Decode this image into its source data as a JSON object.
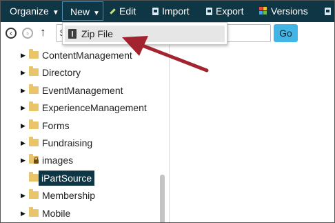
{
  "menubar": {
    "organize": "Organize",
    "new": "New",
    "edit": "Edit",
    "import": "Import",
    "export": "Export",
    "versions": "Versions",
    "caret": "▼"
  },
  "toolbar": {
    "path_value": "$",
    "go_label": "Go"
  },
  "dropdown": {
    "items": [
      {
        "label": "Zip File",
        "icon": "zip-file-icon"
      }
    ]
  },
  "tree": {
    "items": [
      {
        "label": "ContentManagement",
        "icon": "folder-icon",
        "expandable": true
      },
      {
        "label": "Directory",
        "icon": "folder-icon",
        "expandable": true
      },
      {
        "label": "EventManagement",
        "icon": "folder-icon",
        "expandable": true
      },
      {
        "label": "ExperienceManagement",
        "icon": "folder-icon",
        "expandable": true
      },
      {
        "label": "Forms",
        "icon": "folder-icon",
        "expandable": true
      },
      {
        "label": "Fundraising",
        "icon": "folder-icon",
        "expandable": true
      },
      {
        "label": "images",
        "icon": "locked-folder-icon",
        "expandable": true
      },
      {
        "label": "iPartSource",
        "icon": "folder-icon",
        "expandable": false,
        "selected": true
      },
      {
        "label": "Membership",
        "icon": "folder-icon",
        "expandable": true
      },
      {
        "label": "Mobile",
        "icon": "folder-icon",
        "expandable": true
      }
    ]
  },
  "colors": {
    "menubar_bg": "#0f3645",
    "go_button": "#41b6e6",
    "selected_bg": "#0f3645",
    "folder": "#e9c46a",
    "annotation_arrow": "#a3242f"
  }
}
